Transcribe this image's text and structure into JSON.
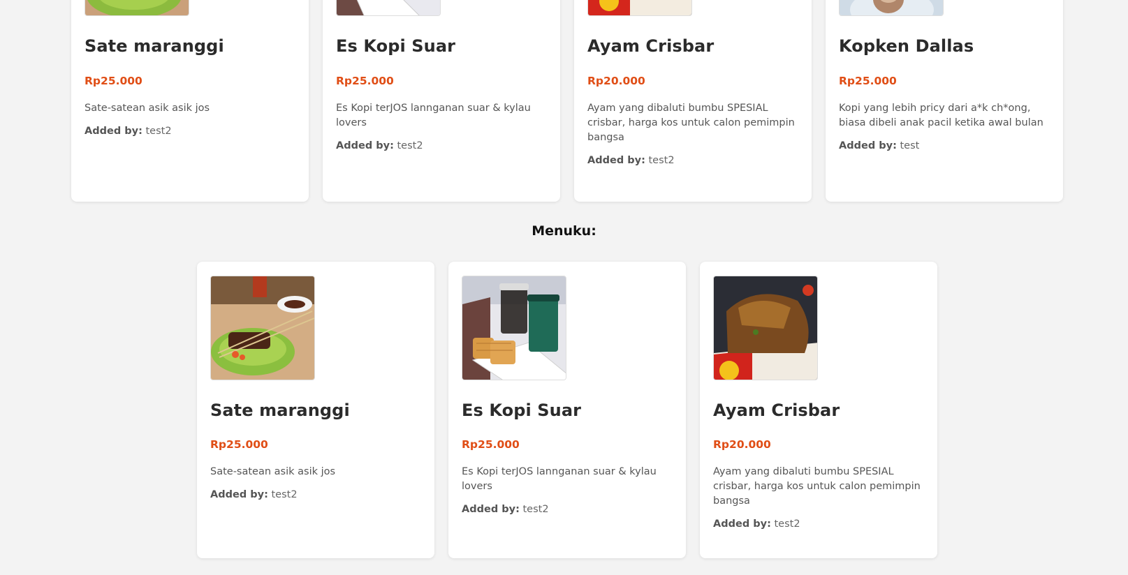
{
  "added_by_label": "Added by:",
  "section": {
    "title": "Menuku:"
  },
  "top_cards": [
    {
      "name": "Sate maranggi",
      "price": "Rp25.000",
      "description": "Sate-satean asik asik jos",
      "added_by": "test2"
    },
    {
      "name": "Es Kopi Suar",
      "price": "Rp25.000",
      "description": "Es Kopi terJOS lannganan suar & kylau lovers",
      "added_by": "test2"
    },
    {
      "name": "Ayam Crisbar",
      "price": "Rp20.000",
      "description": "Ayam yang dibaluti bumbu SPESIAL crisbar, harga kos untuk calon pemimpin bangsa",
      "added_by": "test2"
    },
    {
      "name": "Kopken Dallas",
      "price": "Rp25.000",
      "description": "Kopi yang lebih pricy dari a*k ch*ong, biasa dibeli anak pacil ketika awal bulan",
      "added_by": "test"
    }
  ],
  "my_cards": [
    {
      "name": "Sate maranggi",
      "price": "Rp25.000",
      "description": "Sate-satean asik asik jos",
      "added_by": "test2"
    },
    {
      "name": "Es Kopi Suar",
      "price": "Rp25.000",
      "description": "Es Kopi terJOS lannganan suar & kylau lovers",
      "added_by": "test2"
    },
    {
      "name": "Ayam Crisbar",
      "price": "Rp20.000",
      "description": "Ayam yang dibaluti bumbu SPESIAL crisbar, harga kos untuk calon pemimpin bangsa",
      "added_by": "test2"
    }
  ],
  "colors": {
    "background": "#f3f3f3",
    "card": "#ffffff",
    "price": "#e04e16",
    "title": "#2b2b2b"
  }
}
